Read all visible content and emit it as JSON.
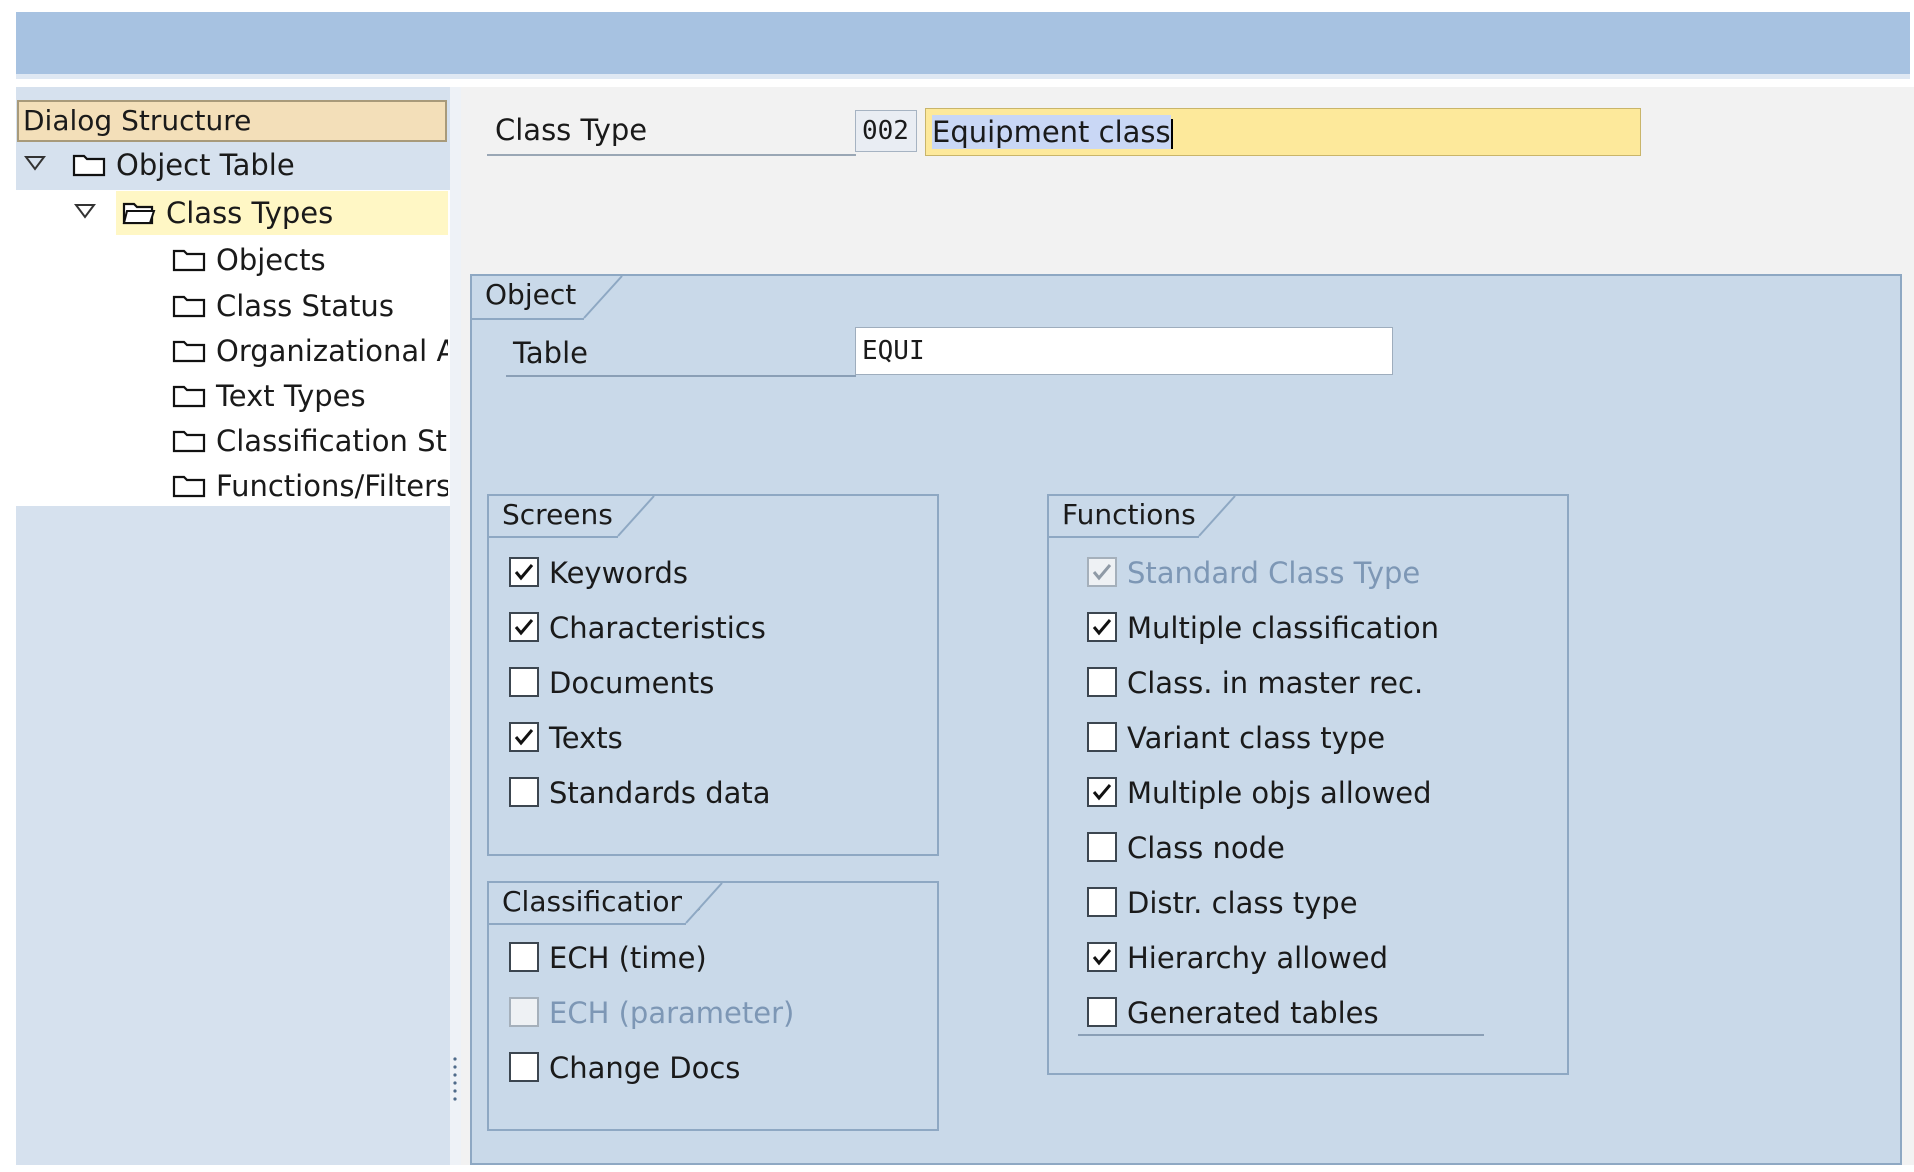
{
  "tree": {
    "header": "Dialog Structure",
    "items": [
      {
        "label": "Object Table"
      },
      {
        "label": "Class Types"
      },
      {
        "label": "Objects"
      },
      {
        "label": "Class Status"
      },
      {
        "label": "Organizational Ar"
      },
      {
        "label": "Text Types"
      },
      {
        "label": "Classification Stat"
      },
      {
        "label": "Functions/Filters"
      }
    ]
  },
  "header": {
    "class_type_label": "Class Type",
    "class_type_code": "002",
    "class_type_text": "Equipment class"
  },
  "object_group": {
    "title": "Object",
    "table_label": "Table",
    "table_value": "EQUI"
  },
  "screens": {
    "title": "Screens",
    "items": [
      {
        "label": "Keywords",
        "checked": true
      },
      {
        "label": "Characteristics",
        "checked": true
      },
      {
        "label": "Documents",
        "checked": false
      },
      {
        "label": "Texts",
        "checked": true
      },
      {
        "label": "Standards data",
        "checked": false
      }
    ]
  },
  "classifications": {
    "title": "Classifications",
    "items": [
      {
        "label": "ECH (time)",
        "checked": false
      },
      {
        "label": "ECH (parameter)",
        "checked": false,
        "disabled": true
      },
      {
        "label": "Change Docs",
        "checked": false
      }
    ]
  },
  "functions": {
    "title": "Functions",
    "items": [
      {
        "label": "Standard Class Type",
        "checked": true,
        "disabled": true
      },
      {
        "label": "Multiple classification",
        "checked": true
      },
      {
        "label": "Class. in master rec.",
        "checked": false
      },
      {
        "label": "Variant class type",
        "checked": false
      },
      {
        "label": "Multiple objs allowed",
        "checked": true
      },
      {
        "label": "Class node",
        "checked": false
      },
      {
        "label": "Distr. class type",
        "checked": false
      },
      {
        "label": "Hierarchy allowed",
        "checked": true
      },
      {
        "label": "Generated tables",
        "checked": false
      }
    ]
  },
  "colors": {
    "title_bar": "#a7c2e1",
    "frame_bg": "#c9d9e9",
    "frame_border": "#8ea8c3",
    "tree_header_bg": "#f3dfb9",
    "selected_row_bg": "#fff7c5",
    "input_highlight_bg": "#fde99b",
    "disabled_text": "#7d97b5"
  }
}
